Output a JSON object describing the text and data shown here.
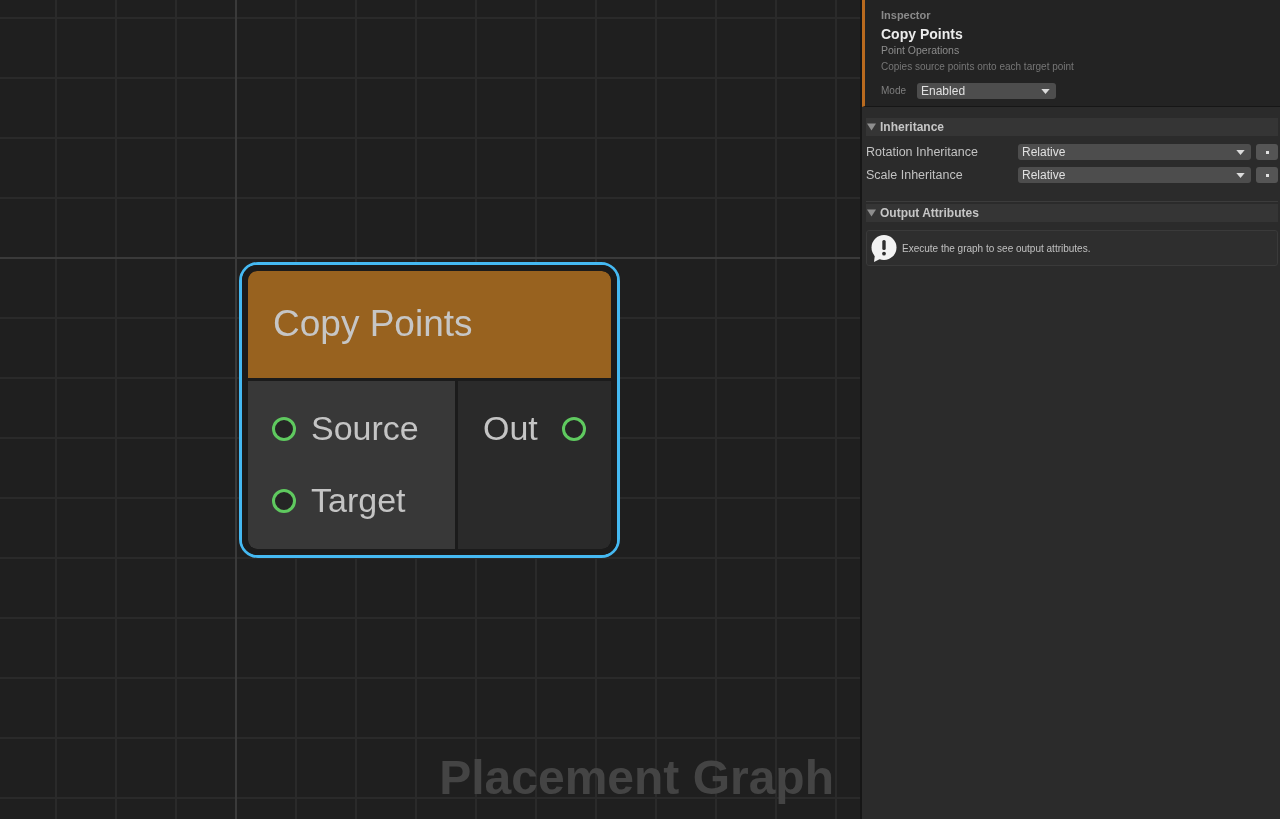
{
  "graph": {
    "graph_name": "Placement Graph",
    "nodes": [
      {
        "title": "Copy Points",
        "selected": true,
        "inputs": [
          {
            "label": "Source"
          },
          {
            "label": "Target"
          }
        ],
        "outputs": [
          {
            "label": "Out"
          }
        ]
      }
    ]
  },
  "inspector": {
    "label": "Inspector",
    "title": "Copy Points",
    "category": "Point Operations",
    "description": "Copies source points onto each target point",
    "mode": {
      "label": "Mode",
      "value": "Enabled"
    },
    "sections": [
      {
        "title": "Inheritance",
        "expanded": true,
        "kind": "fields",
        "fields": [
          {
            "label": "Rotation Inheritance",
            "value": "Relative"
          },
          {
            "label": "Scale Inheritance",
            "value": "Relative"
          }
        ]
      },
      {
        "title": "Output Attributes",
        "expanded": true,
        "kind": "message",
        "message": "Execute the graph to see output attributes."
      }
    ]
  }
}
